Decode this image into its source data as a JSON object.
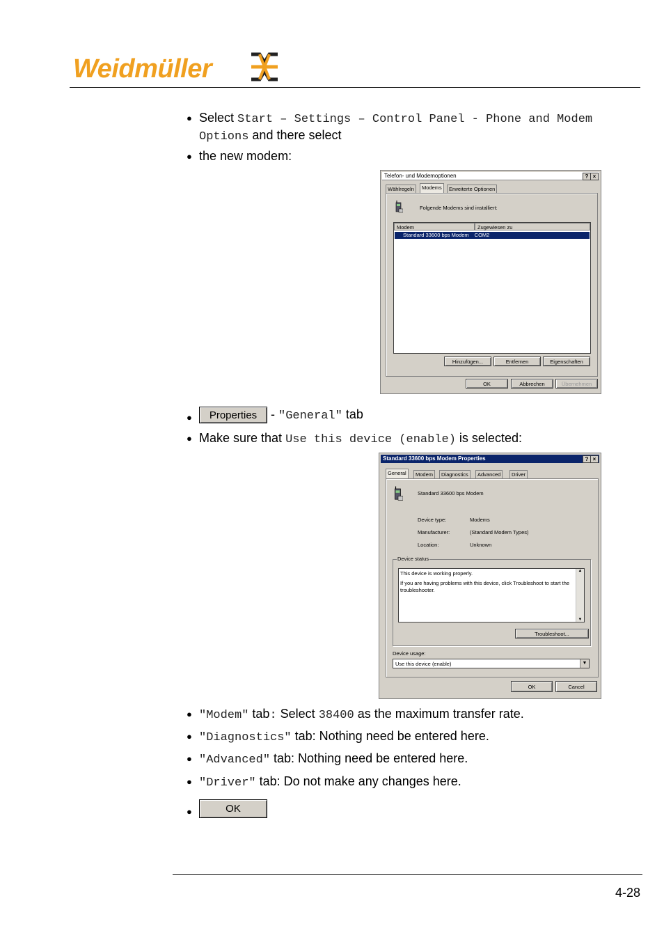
{
  "header": {
    "logo_text": "Weidmüller",
    "brand_color": "#f0a020"
  },
  "bullets": {
    "b1_pre": "Select ",
    "b1_code": "Start – Settings – Control Panel - Phone and Modem Options",
    "b1_post": " and there select",
    "b2": "the new modem:",
    "b3_button": "Properties",
    "b3_sep": " - ",
    "b3_code": "\"General\"",
    "b3_post": " tab",
    "b4_pre": "Make sure that ",
    "b4_code1": "Use this",
    "b4_code2": " device (enable)",
    "b4_post": " is selected:",
    "b5_code": "\"Modem\"",
    "b5_mid": " tab",
    "b5_colon": ":",
    "b5_mid2": " Select ",
    "b5_code2": "38400",
    "b5_post": " as the maximum transfer rate.",
    "b6_code": "\"Diagnostics\"",
    "b6_post": " tab: Nothing need be entered here.",
    "b7_code": "\"Advanced\"",
    "b7_post": " tab: Nothing need be entered here.",
    "b8_code": "\"Driver\"",
    "b8_post": " tab: Do not make any changes here.",
    "b9_button": "OK"
  },
  "dialog1": {
    "title": "Telefon- und Modemoptionen",
    "tabs": [
      "Wählregeln",
      "Modems",
      "Erweiterte Optionen"
    ],
    "info": "Folgende Modems sind installiert:",
    "col_modem": "Modem",
    "col_port": "Zugewiesen zu",
    "row_modem": "Standard 33600 bps Modem",
    "row_port": "COM2",
    "btn_add": "Hinzufügen...",
    "btn_remove": "Entfernen",
    "btn_props": "Eigenschaften",
    "btn_ok": "OK",
    "btn_cancel": "Abbrechen",
    "btn_apply": "Übernehmen",
    "help_glyph": "?",
    "close_glyph": "×"
  },
  "dialog2": {
    "title": "Standard 33600 bps Modem Properties",
    "tabs": [
      "General",
      "Modem",
      "Diagnostics",
      "Advanced",
      "Driver"
    ],
    "device_name": "Standard 33600 bps Modem",
    "device_type_label": "Device type:",
    "device_type_value": "Modems",
    "manufacturer_label": "Manufacturer:",
    "manufacturer_value": "(Standard Modem Types)",
    "location_label": "Location:",
    "location_value": "Unknown",
    "status_group": "Device status",
    "status_line1": "This device is working properly.",
    "status_line2": "If you are having problems with this device, click Troubleshoot to start the troubleshooter.",
    "btn_troubleshoot": "Troubleshoot...",
    "usage_label": "Device usage:",
    "usage_value": "Use this device (enable)",
    "btn_ok": "OK",
    "btn_cancel": "Cancel",
    "help_glyph": "?",
    "close_glyph": "×"
  },
  "footer": {
    "page_number": "4-28"
  }
}
